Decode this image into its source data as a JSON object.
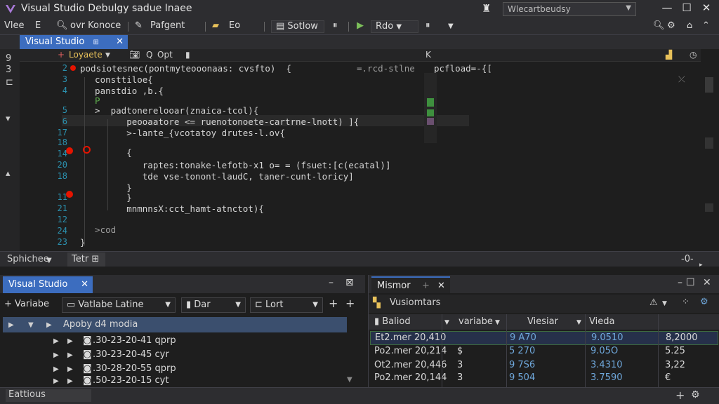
{
  "window": {
    "title": "Visual Studio Debulgy sadue Inaee",
    "search_text": "Wlecartbeudsy",
    "controls": [
      "—",
      "☐",
      "✕"
    ]
  },
  "toolbar": {
    "items": [
      "Vlee",
      "E",
      "ovr Konoce",
      "Pafgent",
      "Eo",
      "Sotlow",
      "Rdo"
    ]
  },
  "doc_tab": {
    "label": "Visual Studio"
  },
  "editor": {
    "header_left": "Loyaete",
    "header_mid": "Opt",
    "header_right": "K",
    "line_numbers": [
      "2",
      "3",
      "4",
      "5",
      "6",
      "17",
      "18",
      "14",
      "20",
      "18",
      "11",
      "21",
      "12",
      "24",
      "23"
    ],
    "lines": [
      "podsiotesnec(pontmyteooonaas: cvsfto)  {",
      "  consttiloe{",
      "  panstdio ,b.{",
      "  P",
      "  >  padtonerelooar(znaica-tcol){",
      "        peooaatore <= ruenotonoete-cartrne-lnott) ]{",
      "        >-lante_{vcotatoy drutes-l.ov{",
      "",
      "        {",
      "           raptes:tonake-lefotb-x1 o= = (fsuet:[c(ecatal)]",
      "           tde vse-tonont-laudC, taner-cunt-loricy]",
      "        }",
      "        }",
      "        mnmnnsX:cct_hamt-atnctot){",
      "",
      "  >cod",
      "}"
    ],
    "right_snippet": "=.rcd-stlne",
    "right_snippet2": "pcfload=-{[",
    "left_gutter": [
      "9",
      "3"
    ]
  },
  "editor_status": {
    "left": "Sphichee",
    "tab": "Tetr",
    "right": "-0-"
  },
  "left_panel": {
    "tab": "Visual Studio",
    "add_label": "Variabe",
    "dropdown1": "Vatlabe Latine",
    "dropdown2": "Dar",
    "dropdown3": "Lort",
    "selected_row": "Apoby d4 modia",
    "rows": [
      ".30-23-20-41 qprp",
      ".30-23-20-45 cyr",
      ".30-28-20-55 qprp",
      ".50-23-20-15 cyt"
    ]
  },
  "right_panel": {
    "tab": "Mismor",
    "header": "Vusiomtars",
    "columns": [
      "Baliod",
      "variabe",
      "Viesiar",
      "Vieda"
    ],
    "rows": [
      [
        "Et2.mer 20,410",
        "",
        "9 A70",
        "9.0510",
        "8,2000"
      ],
      [
        "Po2.mer 20,214",
        "$",
        "5 270",
        "9.05O",
        "5.25"
      ],
      [
        "Ot2.mer 20,446",
        "3",
        "9 7S6",
        "3.4310",
        "3,22"
      ],
      [
        "Po2.mer 20,144",
        "3",
        "9 504",
        "3.7590",
        "€"
      ]
    ]
  },
  "status_bar": {
    "left": "Eattious"
  },
  "colors": {
    "accent": "#3c6dbf",
    "breakpoint": "#e51400",
    "background": "#1e1e1e"
  }
}
